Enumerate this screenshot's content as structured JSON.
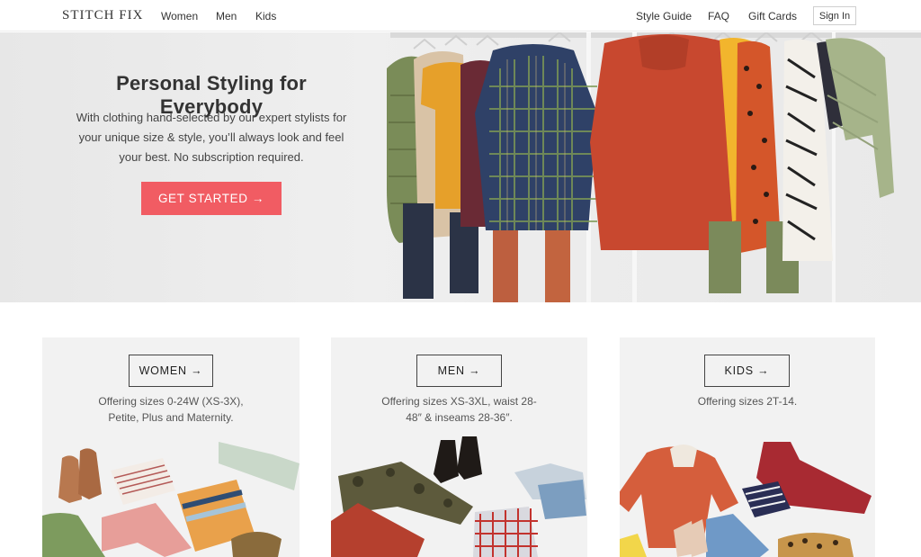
{
  "nav": {
    "logo": "STITCH FIX",
    "left_links": [
      "Women",
      "Men",
      "Kids"
    ],
    "right_links": [
      "Style Guide",
      "FAQ",
      "Gift Cards"
    ],
    "sign_in": "Sign In"
  },
  "hero": {
    "title": "Personal Styling for Everybody",
    "text": "With clothing hand-selected by our expert stylists for your unique size & style, you’ll always look and feel your best. No subscription required.",
    "cta": "GET STARTED →"
  },
  "cards": [
    {
      "button": "WOMEN →",
      "desc_1": "Offering sizes 0-24W (XS-3X),",
      "desc_2": "Petite, Plus and Maternity."
    },
    {
      "button": "MEN →",
      "desc_1": "Offering sizes XS-3XL, waist 28-",
      "desc_2": "48″ & inseams 28-36″."
    },
    {
      "button": "KIDS →",
      "desc_1": "Offering sizes 2T-14.",
      "desc_2": ""
    }
  ],
  "colors": {
    "accent": "#f15c63",
    "text": "#333333",
    "hero_bg": "#ececec",
    "card_bg": "#f2f2f2"
  }
}
